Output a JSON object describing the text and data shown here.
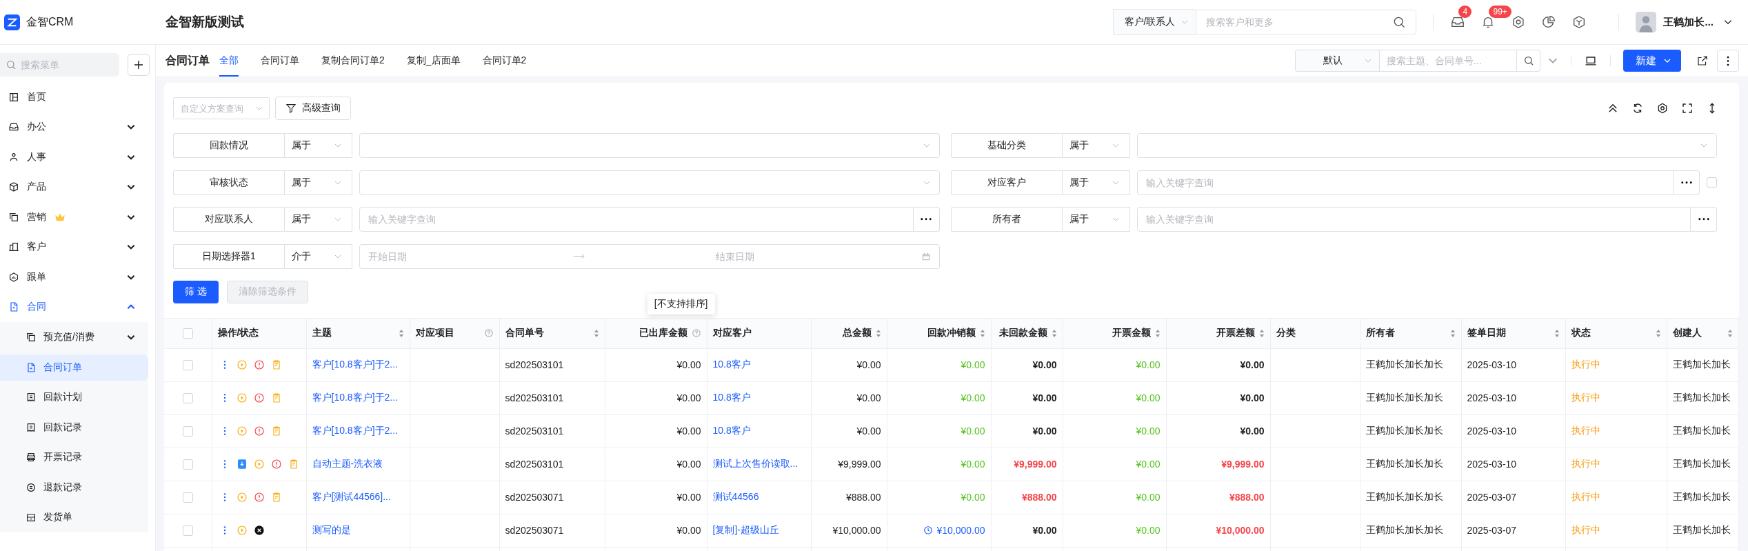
{
  "app": {
    "name": "金智CRM"
  },
  "header": {
    "title": "金智新版测试",
    "search": {
      "scope": "客户/联系人",
      "placeholder": "搜索客户和更多"
    },
    "message_badge": "4",
    "notification_badge": "99+",
    "user": {
      "name": "王鹤加长..."
    }
  },
  "sidebar": {
    "search": {
      "placeholder": "搜索菜单"
    },
    "items": [
      {
        "label": "首页",
        "selected": false
      },
      {
        "label": "办公",
        "selected": false,
        "expanded": false
      },
      {
        "label": "人事",
        "selected": false,
        "expanded": false
      },
      {
        "label": "产品",
        "selected": false,
        "expanded": false
      },
      {
        "label": "营销",
        "selected": false,
        "expanded": false,
        "premium": true
      },
      {
        "label": "客户",
        "selected": false,
        "expanded": false
      },
      {
        "label": "跟单",
        "selected": false,
        "expanded": false
      },
      {
        "label": "合同",
        "selected": true,
        "expanded": true,
        "children": [
          {
            "label": "预充值/消费",
            "selected": false,
            "expanded": false
          },
          {
            "label": "合同订单",
            "selected": true
          },
          {
            "label": "回款计划",
            "selected": false
          },
          {
            "label": "回款记录",
            "selected": false
          },
          {
            "label": "开票记录",
            "selected": false
          },
          {
            "label": "退款记录",
            "selected": false
          },
          {
            "label": "发货单",
            "selected": false
          }
        ]
      }
    ]
  },
  "page": {
    "title": "合同订单",
    "tabs": [
      {
        "label": "全部",
        "selected": true
      },
      {
        "label": "合同订单",
        "selected": false
      },
      {
        "label": "复制合同订单2",
        "selected": false
      },
      {
        "label": "复制_店面单",
        "selected": false
      },
      {
        "label": "合同订单2",
        "selected": false
      }
    ],
    "view": "默认",
    "search": {
      "placeholder": "搜索主题、合同单号..."
    },
    "new_button": "新建"
  },
  "filters": {
    "scheme": {
      "placeholder": "自定义方案查询"
    },
    "advanced_button": "高级查询",
    "fields": [
      {
        "label": "回款情况",
        "operator": "属于",
        "kind": "select"
      },
      {
        "label": "基础分类",
        "operator": "属于",
        "kind": "select"
      },
      {
        "label": "审核状态",
        "operator": "属于",
        "kind": "select"
      },
      {
        "label": "对应客户",
        "operator": "属于",
        "kind": "lookup",
        "placeholder": "输入关键字查询",
        "checked": false
      },
      {
        "label": "对应联系人",
        "operator": "属于",
        "kind": "lookup",
        "placeholder": "输入关键字查询"
      },
      {
        "label": "所有者",
        "operator": "属于",
        "kind": "lookup",
        "placeholder": "输入关键字查询"
      },
      {
        "label": "日期选择器1",
        "operator": "介于",
        "kind": "daterange",
        "start_placeholder": "开始日期",
        "end_placeholder": "结束日期"
      }
    ],
    "apply_button": "筛 选",
    "clear_button": {
      "label": "清除筛选条件",
      "disabled": true
    }
  },
  "table": {
    "all_selected": false,
    "columns": [
      {
        "label": "操作/状态"
      },
      {
        "label": "主题",
        "sortable": true
      },
      {
        "label": "对应项目",
        "help": true
      },
      {
        "label": "合同单号",
        "sortable": true
      },
      {
        "label": "已出库金额",
        "help": true,
        "tooltip": "[不支持排序]"
      },
      {
        "label": "对应客户"
      },
      {
        "label": "总金额",
        "sortable": true
      },
      {
        "label": "回款冲销额",
        "sortable": true
      },
      {
        "label": "未回款金额",
        "sortable": true
      },
      {
        "label": "开票金额",
        "sortable": true
      },
      {
        "label": "开票差额",
        "sortable": true
      },
      {
        "label": "分类"
      },
      {
        "label": "所有者",
        "sortable": true
      },
      {
        "label": "签单日期",
        "sortable": true
      },
      {
        "label": "状态",
        "sortable": true
      },
      {
        "label": "创建人",
        "sortable": true
      }
    ],
    "rows": [
      {
        "selected": false,
        "actions": [
          {
            "kind": "play"
          },
          {
            "kind": "alert"
          },
          {
            "kind": "note"
          }
        ],
        "subject": "客户[10.8客户]于2...",
        "number": "sd202503101",
        "shipped": "¥0.00",
        "customer": "10.8客户",
        "total": "¥0.00",
        "writeoff": {
          "text": "¥0.00",
          "pending": false
        },
        "unpaid": {
          "text": "¥0.00",
          "alert": false
        },
        "invoiced": "¥0.00",
        "invoice_diff": {
          "text": "¥0.00",
          "alert": false
        },
        "owner": "王鹤加长加长加长",
        "date": "2025-03-10",
        "status": "执行中",
        "creator": "王鹤加长加长"
      },
      {
        "selected": false,
        "actions": [
          {
            "kind": "play"
          },
          {
            "kind": "alert"
          },
          {
            "kind": "note"
          }
        ],
        "subject": "客户[10.8客户]于2...",
        "number": "sd202503101",
        "shipped": "¥0.00",
        "customer": "10.8客户",
        "total": "¥0.00",
        "writeoff": {
          "text": "¥0.00",
          "pending": false
        },
        "unpaid": {
          "text": "¥0.00",
          "alert": false
        },
        "invoiced": "¥0.00",
        "invoice_diff": {
          "text": "¥0.00",
          "alert": false
        },
        "owner": "王鹤加长加长加长",
        "date": "2025-03-10",
        "status": "执行中",
        "creator": "王鹤加长加长"
      },
      {
        "selected": false,
        "actions": [
          {
            "kind": "play"
          },
          {
            "kind": "alert"
          },
          {
            "kind": "note"
          }
        ],
        "subject": "客户[10.8客户]于2...",
        "number": "sd202503101",
        "shipped": "¥0.00",
        "customer": "10.8客户",
        "total": "¥0.00",
        "writeoff": {
          "text": "¥0.00",
          "pending": false
        },
        "unpaid": {
          "text": "¥0.00",
          "alert": false
        },
        "invoiced": "¥0.00",
        "invoice_diff": {
          "text": "¥0.00",
          "alert": false
        },
        "owner": "王鹤加长加长加长",
        "date": "2025-03-10",
        "status": "执行中",
        "creator": "王鹤加长加长"
      },
      {
        "selected": false,
        "actions": [
          {
            "kind": "doc"
          },
          {
            "kind": "play"
          },
          {
            "kind": "alert"
          },
          {
            "kind": "note"
          }
        ],
        "subject": "自动主题-洗衣液",
        "number": "sd202503101",
        "shipped": "¥0.00",
        "customer": "测试上次售价读取...",
        "total": "¥9,999.00",
        "writeoff": {
          "text": "¥0.00",
          "pending": false
        },
        "unpaid": {
          "text": "¥9,999.00",
          "alert": true
        },
        "invoiced": "¥0.00",
        "invoice_diff": {
          "text": "¥9,999.00",
          "alert": true
        },
        "owner": "王鹤加长加长加长",
        "date": "2025-03-10",
        "status": "执行中",
        "creator": "王鹤加长加长"
      },
      {
        "selected": false,
        "actions": [
          {
            "kind": "play"
          },
          {
            "kind": "alert"
          },
          {
            "kind": "note"
          }
        ],
        "subject": "客户[测试44566]...",
        "number": "sd202503071",
        "shipped": "¥0.00",
        "customer": "测试44566",
        "total": "¥888.00",
        "writeoff": {
          "text": "¥0.00",
          "pending": false
        },
        "unpaid": {
          "text": "¥888.00",
          "alert": true
        },
        "invoiced": "¥0.00",
        "invoice_diff": {
          "text": "¥888.00",
          "alert": true
        },
        "owner": "王鹤加长加长加长",
        "date": "2025-03-07",
        "status": "执行中",
        "creator": "王鹤加长加长"
      },
      {
        "selected": false,
        "actions": [
          {
            "kind": "play"
          },
          {
            "kind": "cancel"
          }
        ],
        "subject": "测写的是",
        "number": "sd202503071",
        "shipped": "¥0.00",
        "customer": "[复制]-超级山丘",
        "total": "¥10,000.00",
        "writeoff": {
          "text": "¥10,000.00",
          "pending": true
        },
        "unpaid": {
          "text": "¥0.00",
          "alert": false
        },
        "invoiced": "¥0.00",
        "invoice_diff": {
          "text": "¥10,000.00",
          "alert": true
        },
        "owner": "王鹤加长加长加长",
        "date": "2025-03-07",
        "status": "执行中",
        "creator": "王鹤加长加长"
      }
    ]
  }
}
